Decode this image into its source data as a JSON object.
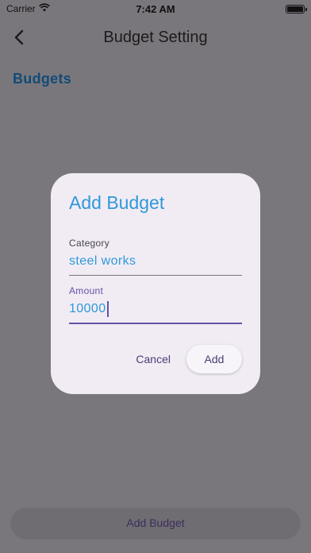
{
  "status_bar": {
    "carrier": "Carrier",
    "time": "7:42 AM"
  },
  "app_bar": {
    "title": "Budget Setting"
  },
  "section": {
    "title": "Budgets"
  },
  "bottom": {
    "add_budget_label": "Add Budget"
  },
  "dialog": {
    "title": "Add Budget",
    "category": {
      "label": "Category",
      "value": "steel works"
    },
    "amount": {
      "label": "Amount",
      "value": "10000"
    },
    "cancel_label": "Cancel",
    "add_label": "Add"
  },
  "colors": {
    "accent": "#2f98d9",
    "primary": "#6750a4",
    "scrim_background": "#7a777c",
    "dialog_background": "#f1ecf4"
  },
  "icons": [
    "wifi-icon",
    "battery-icon",
    "back-arrow-icon"
  ]
}
